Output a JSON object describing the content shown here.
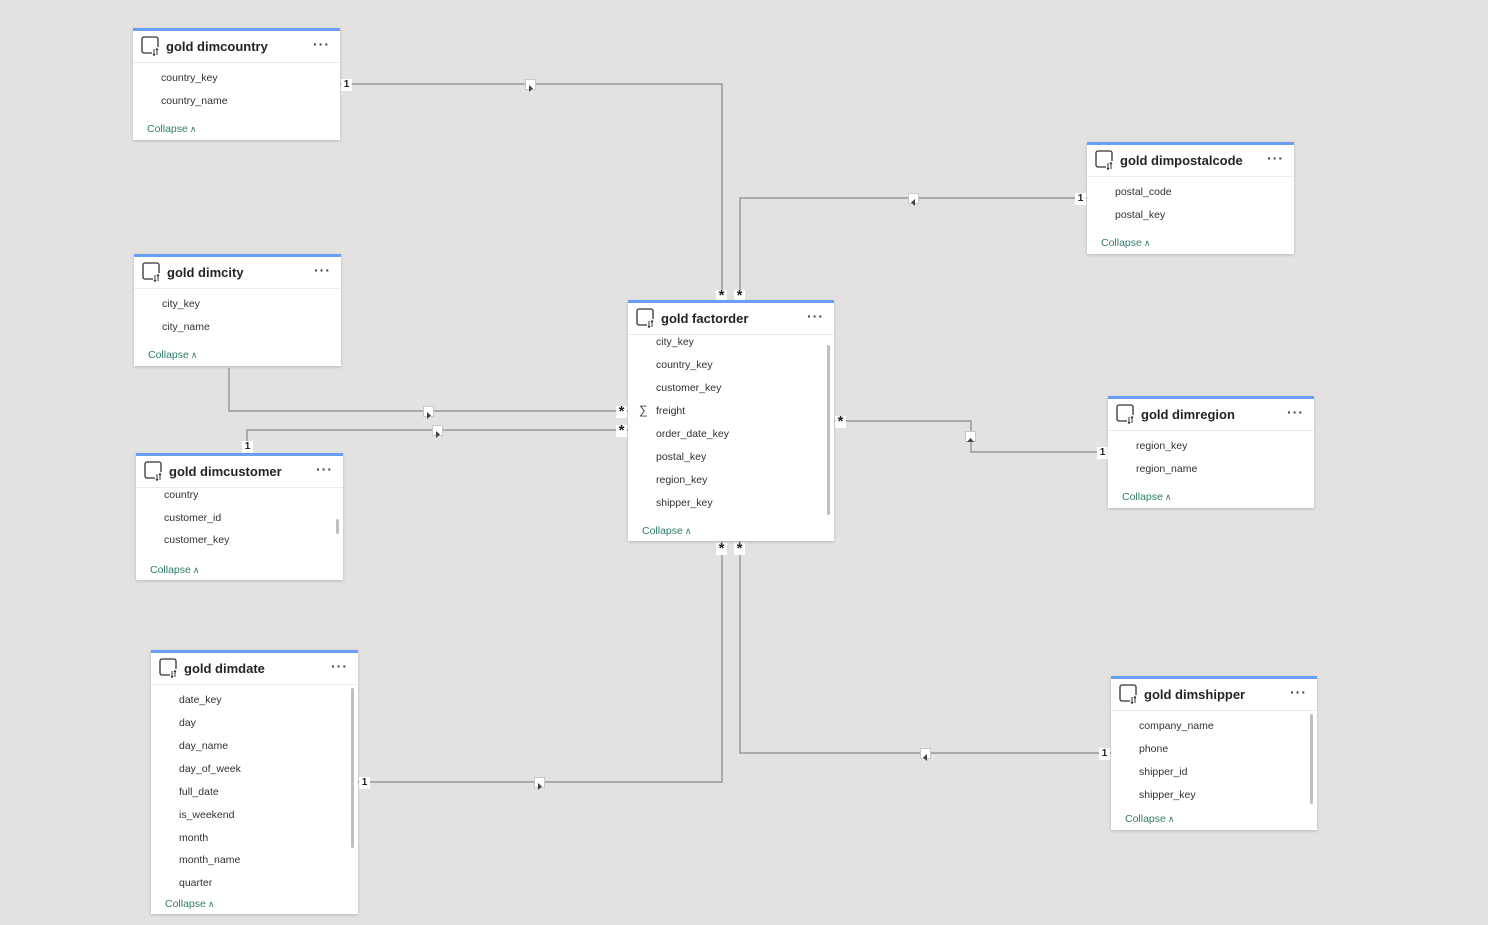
{
  "tables": {
    "dimcountry": {
      "title": "gold dimcountry",
      "fields": [
        "country_key",
        "country_name"
      ],
      "collapse": "Collapse"
    },
    "dimcity": {
      "title": "gold dimcity",
      "fields": [
        "city_key",
        "city_name"
      ],
      "collapse": "Collapse"
    },
    "dimcustomer": {
      "title": "gold dimcustomer",
      "fields": [
        "country",
        "customer_id",
        "customer_key"
      ],
      "collapse": "Collapse"
    },
    "dimdate": {
      "title": "gold dimdate",
      "fields": [
        "date_key",
        "day",
        "day_name",
        "day_of_week",
        "full_date",
        "is_weekend",
        "month",
        "month_name",
        "quarter"
      ],
      "collapse": "Collapse"
    },
    "factorder": {
      "title": "gold factorder",
      "fields": [
        "city_key",
        "country_key",
        "customer_key",
        "freight",
        "order_date_key",
        "postal_key",
        "region_key",
        "shipper_key"
      ],
      "collapse": "Collapse"
    },
    "dimpostalcode": {
      "title": "gold dimpostalcode",
      "fields": [
        "postal_code",
        "postal_key"
      ],
      "collapse": "Collapse"
    },
    "dimregion": {
      "title": "gold dimregion",
      "fields": [
        "region_key",
        "region_name"
      ],
      "collapse": "Collapse"
    },
    "dimshipper": {
      "title": "gold dimshipper",
      "fields": [
        "company_name",
        "phone",
        "shipper_id",
        "shipper_key"
      ],
      "collapse": "Collapse"
    }
  },
  "more_label": "···",
  "cardinality": {
    "one": "1",
    "many": "*"
  },
  "colors": {
    "accent": "#6a9ef4",
    "line": "#8a8886",
    "link": "#2e7d6a",
    "canvas": "#e4e2e0"
  },
  "icons": {
    "table": "table-icon",
    "more": "more-options-icon",
    "collapse": "chevron-up-icon",
    "measure": "sigma-icon",
    "direction": "filter-direction-icon"
  }
}
